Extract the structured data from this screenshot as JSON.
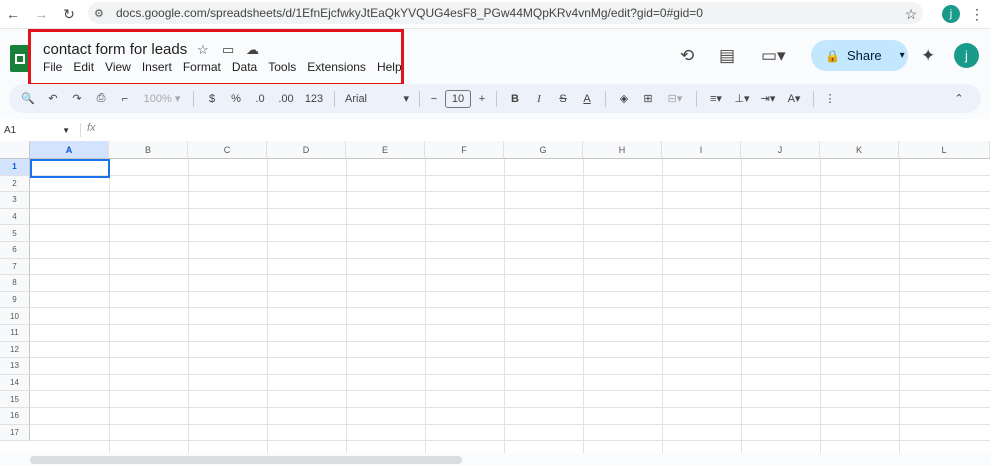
{
  "browser": {
    "url": "docs.google.com/spreadsheets/d/1EfnEjcfwkyJtEaQkYVQUG4esF8_PGw44MQpKRv4vnMg/edit?gid=0#gid=0",
    "profile_initial": "j"
  },
  "doc": {
    "title": "contact form for leads"
  },
  "menu": [
    "File",
    "Edit",
    "View",
    "Insert",
    "Format",
    "Data",
    "Tools",
    "Extensions",
    "Help"
  ],
  "header": {
    "share_label": "Share",
    "avatar_initial": "j"
  },
  "toolbar": {
    "zoom": "100%",
    "currency": "$",
    "percent": "%",
    "decrease_decimal": ".0",
    "increase_decimal": ".00",
    "number_format": "123",
    "font": "Arial",
    "font_size": "10",
    "bold": "B",
    "italic": "I",
    "text_color": "A"
  },
  "formula_bar": {
    "cell_ref": "A1",
    "fx": "fx"
  },
  "grid": {
    "columns": [
      "A",
      "B",
      "C",
      "D",
      "E",
      "F",
      "G",
      "H",
      "I",
      "J",
      "K",
      "L"
    ],
    "rows": [
      "1",
      "2",
      "3",
      "4",
      "5",
      "6",
      "7",
      "8",
      "9",
      "10",
      "11",
      "12",
      "13",
      "14",
      "15",
      "16",
      "17"
    ]
  },
  "colors": {
    "highlight_border": "#e1131d",
    "share_bg": "#c2e7ff",
    "selection": "#1a73e8",
    "sheets_green": "#188038"
  }
}
